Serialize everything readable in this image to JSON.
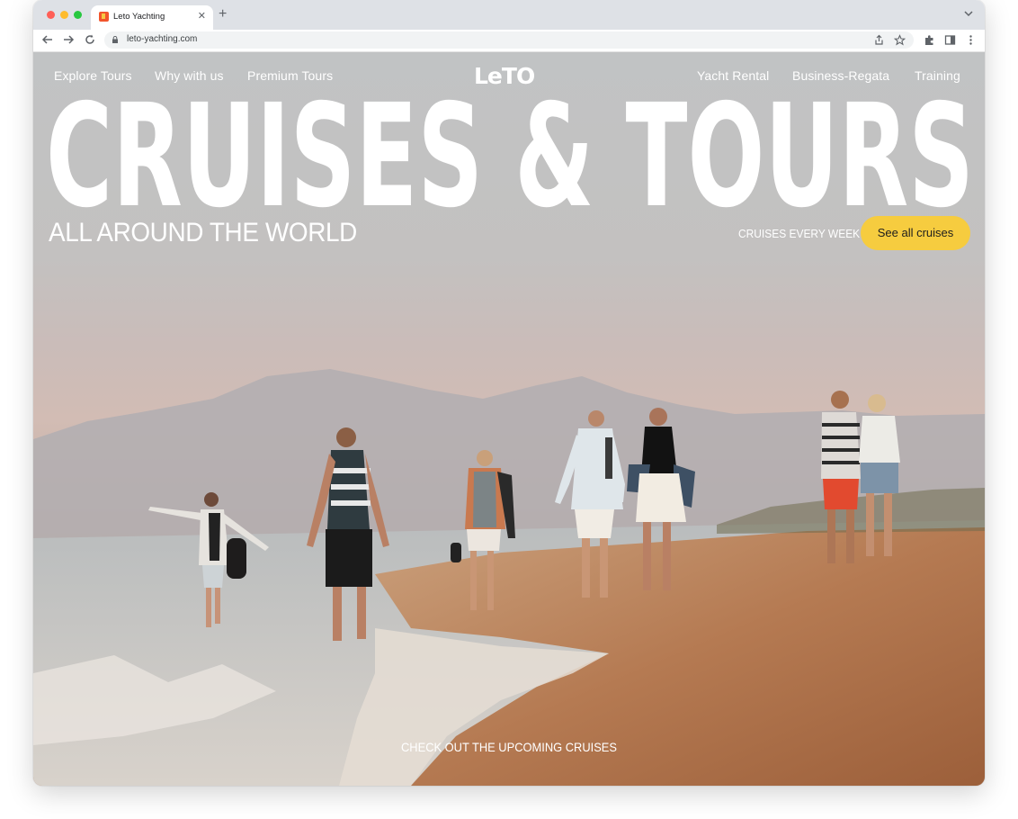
{
  "browser": {
    "tab_title": "Leto Yachting",
    "url": "leto-yachting.com"
  },
  "site": {
    "logo": "LeTO",
    "nav_left": [
      "Explore Tours",
      "Why with us",
      "Premium Tours"
    ],
    "nav_right": [
      "Yacht Rental",
      "Business-Regata",
      "Training"
    ]
  },
  "hero": {
    "headline": "CRUISES & TOURS",
    "subtitle": "ALL AROUND THE WORLD",
    "tagline": "CRUISES EVERY WEEK",
    "cta_label": "See all cruises",
    "bottom_link": "CHECK OUT THE UPCOMING CRUISES"
  },
  "colors": {
    "cta": "#f6cc3f",
    "tab_strip": "#dee1e6"
  }
}
